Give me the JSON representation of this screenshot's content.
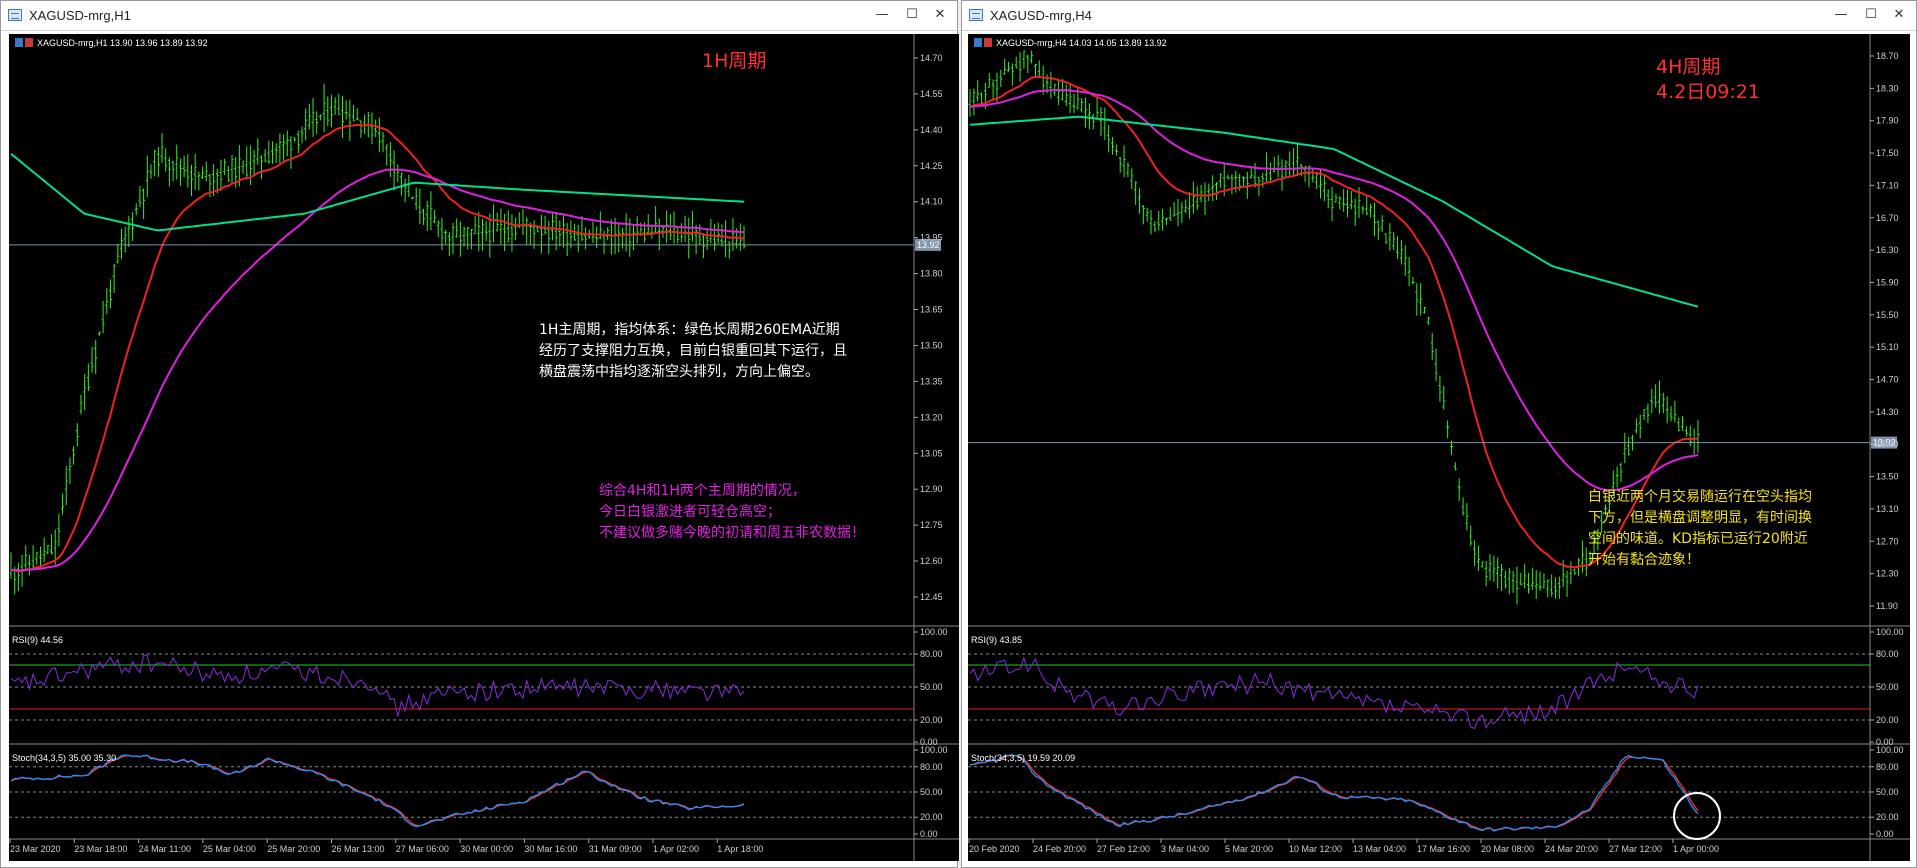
{
  "colors": {
    "up": "#33ee22",
    "ema_fast": "#ee2222",
    "ema_mid": "#e020e0",
    "ema_slow": "#00e08a",
    "rsi": "#8a2be2",
    "stoch_main": "#1e90ff",
    "stoch_sig": "#ff3030",
    "level_hi": "#1ec81e",
    "level_lo": "#e02020",
    "bid": "#7e95ad"
  },
  "left": {
    "window_title": "XAGUSD-mrg,H1",
    "minimize": "—",
    "maximize": "☐",
    "close": "✕",
    "header": "XAGUSD-mrg,H1  13.90 13.96 13.89 13.92",
    "period_label": "1H周期",
    "current_price": "13.92",
    "price_axis": [
      "14.70",
      "14.55",
      "14.40",
      "14.25",
      "14.10",
      "13.95",
      "13.80",
      "13.65",
      "13.50",
      "13.35",
      "13.20",
      "13.05",
      "12.90",
      "12.75",
      "12.60",
      "12.45"
    ],
    "rsi_label": "RSI(9) 44.56",
    "stoch_label": "Stoch(34,3,5) 35.00 35.30",
    "osc_axis": [
      "100.00",
      "80.00",
      "50.00",
      "20.00",
      "0.00"
    ],
    "dates": [
      "23 Mar 2020",
      "23 Mar 18:00",
      "24 Mar 11:00",
      "25 Mar 04:00",
      "25 Mar 20:00",
      "26 Mar 13:00",
      "27 Mar 06:00",
      "30 Mar 00:00",
      "30 Mar 16:00",
      "31 Mar 09:00",
      "1 Apr 02:00",
      "1 Apr 18:00"
    ],
    "note_white": [
      "1H主周期，指均体系：绿色长周期260EMA近期",
      "经历了支撑阻力互换，目前白银重回其下运行，且",
      "横盘震荡中指均逐渐空头排列，方向上偏空。"
    ],
    "note_magenta": [
      "综合4H和1H两个主周期的情况，",
      "今日白银激进者可轻仓高空；",
      "不建议做多赌今晚的初请和周五非农数据！"
    ]
  },
  "right": {
    "window_title": "XAGUSD-mrg,H4",
    "minimize": "—",
    "maximize": "☐",
    "close": "✕",
    "header": "XAGUSD-mrg,H4  14.03 14.05 13.89 13.92",
    "period_label": "4H周期",
    "period_sub": "4.2日09:21",
    "current_price": "13.92",
    "price_axis": [
      "18.70",
      "18.30",
      "17.90",
      "17.50",
      "17.10",
      "16.70",
      "16.30",
      "15.90",
      "15.50",
      "15.10",
      "14.70",
      "14.30",
      "13.90",
      "13.50",
      "13.10",
      "12.70",
      "12.30",
      "11.90"
    ],
    "rsi_label": "RSI(9) 43.85",
    "stoch_label": "Stoch(34,3,5) 19.59 20.09",
    "osc_axis": [
      "100.00",
      "80.00",
      "50.00",
      "20.00",
      "0.00"
    ],
    "dates": [
      "20 Feb 2020",
      "24 Feb 20:00",
      "27 Feb 12:00",
      "3 Mar 04:00",
      "5 Mar 20:00",
      "10 Mar 12:00",
      "13 Mar 04:00",
      "17 Mar 16:00",
      "20 Mar 08:00",
      "24 Mar 20:00",
      "27 Mar 12:00",
      "1 Apr 00:00"
    ],
    "note_yellow": [
      "白银近两个月交易随运行在空头指均",
      "下方，但是横盘调整明显，有时间换",
      "空间的味道。KD指标已运行20附近",
      "开始有黏合迹象！"
    ]
  }
}
